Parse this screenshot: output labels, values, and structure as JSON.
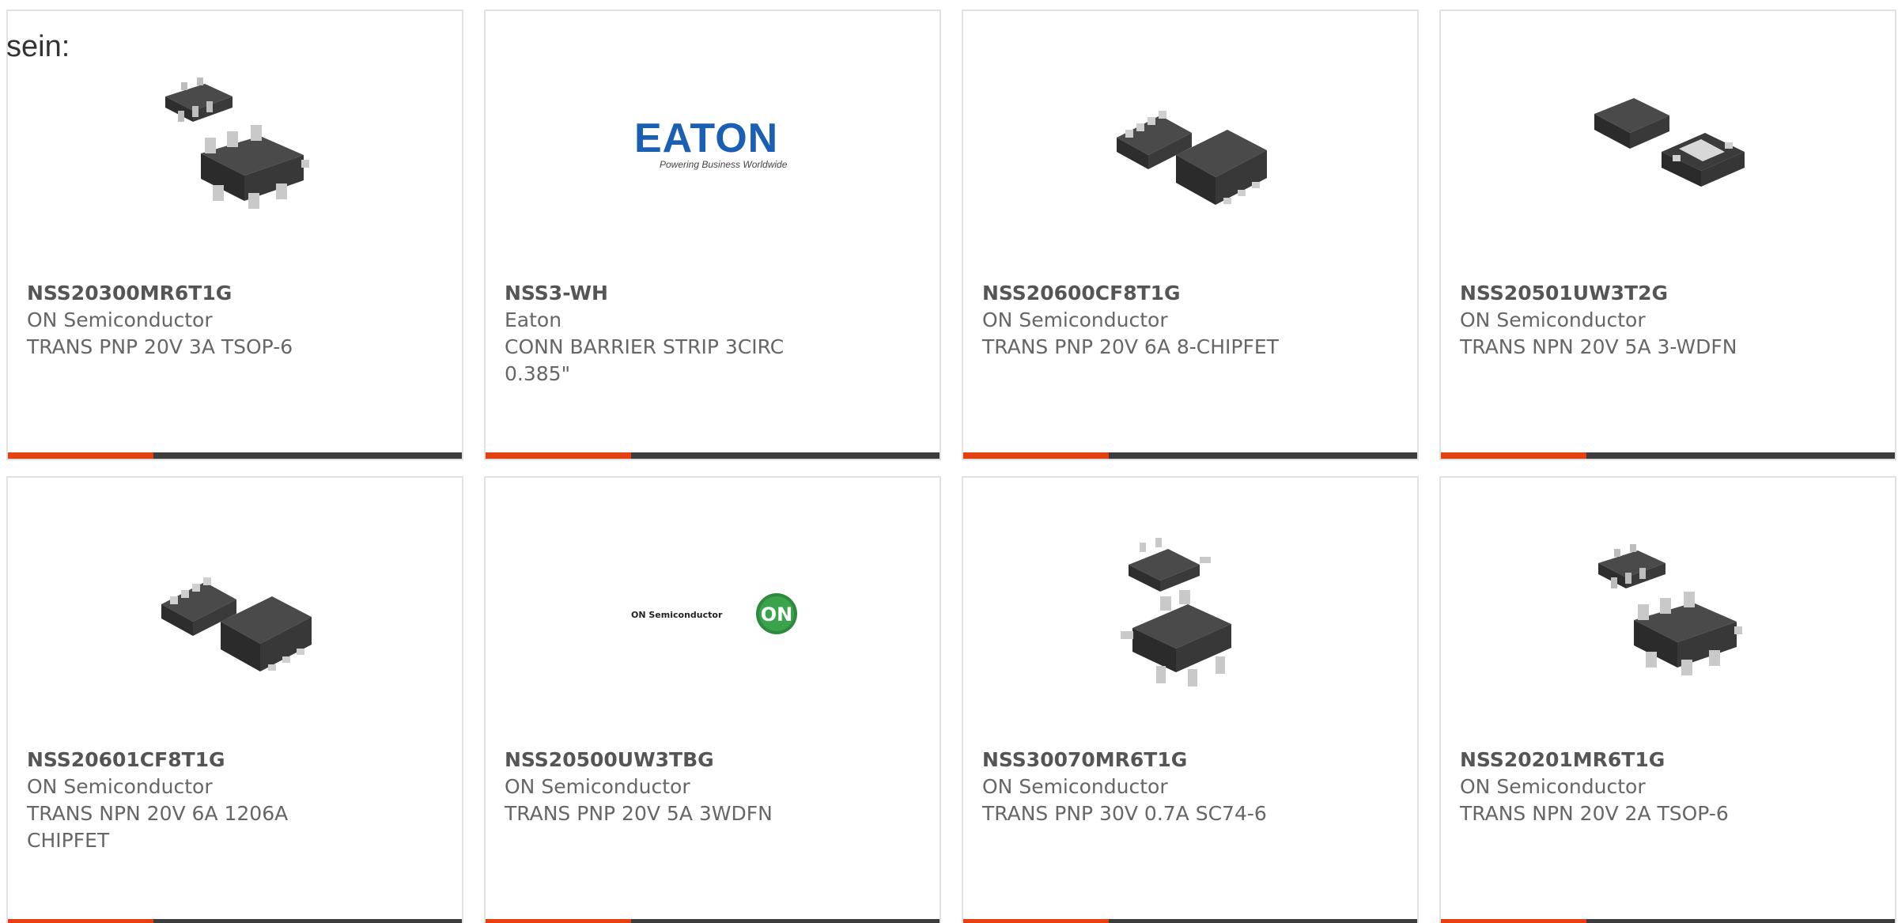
{
  "lead_text": "sein:",
  "colors": {
    "accent": "#e44012",
    "bar_dark": "#3c3c3c",
    "card_border": "#e2e2e2",
    "text": "#666666"
  },
  "products": [
    {
      "part": "NSS20300MR6T1G",
      "maker": "ON Semiconductor",
      "desc": "TRANS PNP 20V 3A TSOP-6",
      "image": "tsop6-dual-chip-image"
    },
    {
      "part": "NSS3-WH",
      "maker": "Eaton",
      "desc": "CONN BARRIER STRIP 3CIRC 0.385\"",
      "image": "eaton-logo"
    },
    {
      "part": "NSS20600CF8T1G",
      "maker": "ON Semiconductor",
      "desc": "TRANS PNP 20V 6A 8-CHIPFET",
      "image": "chipfet-dual-chip-image"
    },
    {
      "part": "NSS20501UW3T2G",
      "maker": "ON Semiconductor",
      "desc": "TRANS NPN 20V 5A 3-WDFN",
      "image": "wdfn-dual-chip-image"
    },
    {
      "part": "NSS20601CF8T1G",
      "maker": "ON Semiconductor",
      "desc": "TRANS NPN 20V 6A 1206A CHIPFET",
      "image": "chipfet-dual-chip-image"
    },
    {
      "part": "NSS20500UW3TBG",
      "maker": "ON Semiconductor",
      "desc": "TRANS PNP 20V 5A 3WDFN",
      "image": "on-semiconductor-logo"
    },
    {
      "part": "NSS30070MR6T1G",
      "maker": "ON Semiconductor",
      "desc": "TRANS PNP 30V 0.7A SC74-6",
      "image": "sc74-dual-chip-image"
    },
    {
      "part": "NSS20201MR6T1G",
      "maker": "ON Semiconductor",
      "desc": "TRANS NPN 20V 2A TSOP-6",
      "image": "tsop6-dual-chip-image"
    }
  ],
  "logos": {
    "eaton_wordmark": "EATON",
    "eaton_tagline": "Powering Business Worldwide",
    "on_wordmark": "ON Semiconductor",
    "on_badge": "ON"
  }
}
